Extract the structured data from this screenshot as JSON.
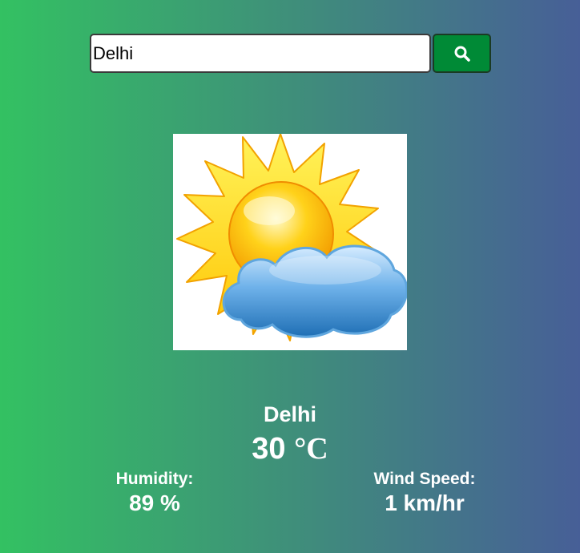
{
  "search": {
    "value": "Delhi",
    "button_icon": "search-icon"
  },
  "weather": {
    "icon": "partly-cloudy-icon",
    "city": "Delhi",
    "temperature_value": "30",
    "temperature_unit": "°C",
    "humidity_label": "Humidity:",
    "humidity_value": "89 %",
    "wind_label": "Wind Speed:",
    "wind_value": "1 km/hr"
  },
  "colors": {
    "gradient_start": "#33c162",
    "gradient_end": "#475f97",
    "search_button": "#008a36"
  }
}
